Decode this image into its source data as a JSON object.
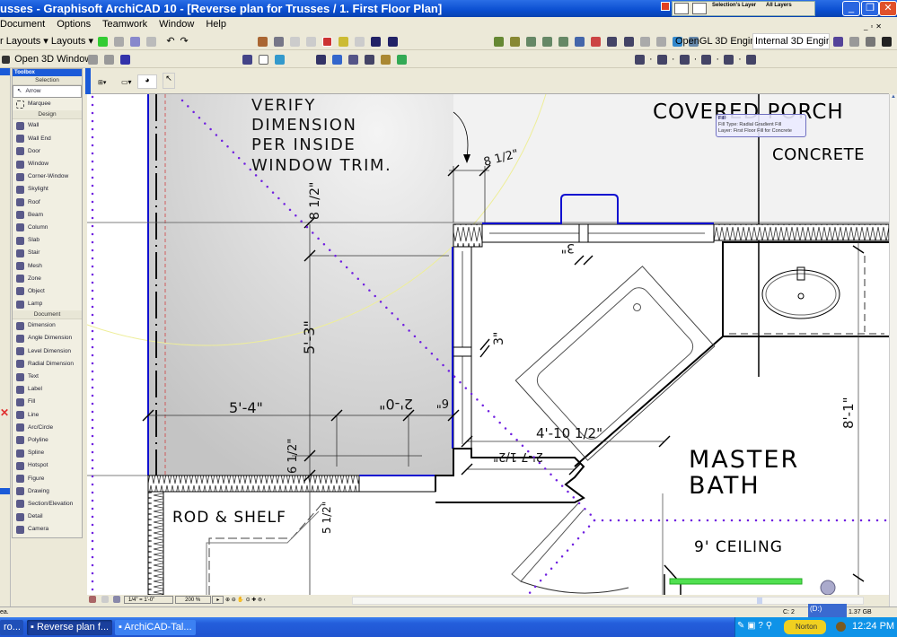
{
  "window": {
    "title": "usses - Graphisoft ArchiCAD 10 - [Reverse plan for Trusses / 1. First Floor Plan]",
    "layer_palette": {
      "selections_layer": "Selection's Layer",
      "all_layers": "All Layers"
    }
  },
  "menu": [
    "Document",
    "Options",
    "Teamwork",
    "Window",
    "Help"
  ],
  "toolbar1": {
    "layouts_left": "r Layouts",
    "layouts": "Layouts",
    "engine_label": "OpenGL 3D Engine",
    "engine_select": "Internal 3D Engine"
  },
  "toolbar2": {
    "open3d": "Open 3D Window"
  },
  "toolbox": {
    "title": "Toolbox",
    "sections": [
      {
        "label": "Selection",
        "tools": [
          "Arrow",
          "Marquee"
        ]
      },
      {
        "label": "Design",
        "tools": [
          "Wall",
          "Wall End",
          "Door",
          "Window",
          "Corner-Window",
          "Skylight",
          "Roof",
          "Beam",
          "Column",
          "Slab",
          "Stair",
          "Mesh",
          "Zone",
          "Object",
          "Lamp"
        ]
      },
      {
        "label": "Document",
        "tools": [
          "Dimension",
          "Angle Dimension",
          "Level Dimension",
          "Radial Dimension",
          "Text",
          "Label",
          "Fill",
          "Line",
          "Arc/Circle",
          "Polyline",
          "Spline",
          "Hotspot",
          "Figure",
          "Drawing",
          "Section/Elevation",
          "Detail",
          "Camera"
        ]
      }
    ],
    "selected": "Arrow"
  },
  "plan": {
    "note": [
      "VERIFY",
      "DIMENSION",
      "PER INSIDE",
      "WINDOW TRIM."
    ],
    "covered_porch": "COVERED PORCH",
    "concrete": "CONCRETE",
    "master": "MASTER",
    "bath": "BATH",
    "ceiling": "9' CEILING",
    "rod_shelf": "ROD & SHELF",
    "dims": {
      "d1": "8 1/2\"",
      "d2": "8 1/2\"",
      "d3": "5'-3\"",
      "d4": "5'-4\"",
      "d5": "2'-0\"",
      "d6": "6\"",
      "d7": "6 1/2\"",
      "d8": "5 1/2\"",
      "d9": "3\"",
      "d10": "3\"",
      "d11": "4'-10 1/2\"",
      "d12": "2'-7 1/2\"",
      "d13": "8'-1\""
    }
  },
  "tooltip": {
    "title": "Fill",
    "type": "Fill Type: Radial Gradient Fill",
    "layer": "Layer: First Floor Fill for Concrete"
  },
  "navbar": {
    "scale": "1/4\"  =  1'-0\"",
    "zoom": "200 %"
  },
  "status": {
    "left": "ea.",
    "drive_c": "C: 2",
    "drive_d": "(D:)",
    "free": "1.37 GB"
  },
  "taskbar": {
    "items": [
      "ro...",
      "Reverse plan f...",
      "ArchiCAD-Tal..."
    ],
    "norton": "Norton",
    "clock": "12:24 PM"
  },
  "colors": {
    "titlebar": "#0a4ed0",
    "wall_outline": "#1010d0",
    "grid_dots": "#7020e0",
    "arc": "#f0f0a0",
    "fill_gradient": "#c8c8c8",
    "highlight_green": "#50e050"
  }
}
